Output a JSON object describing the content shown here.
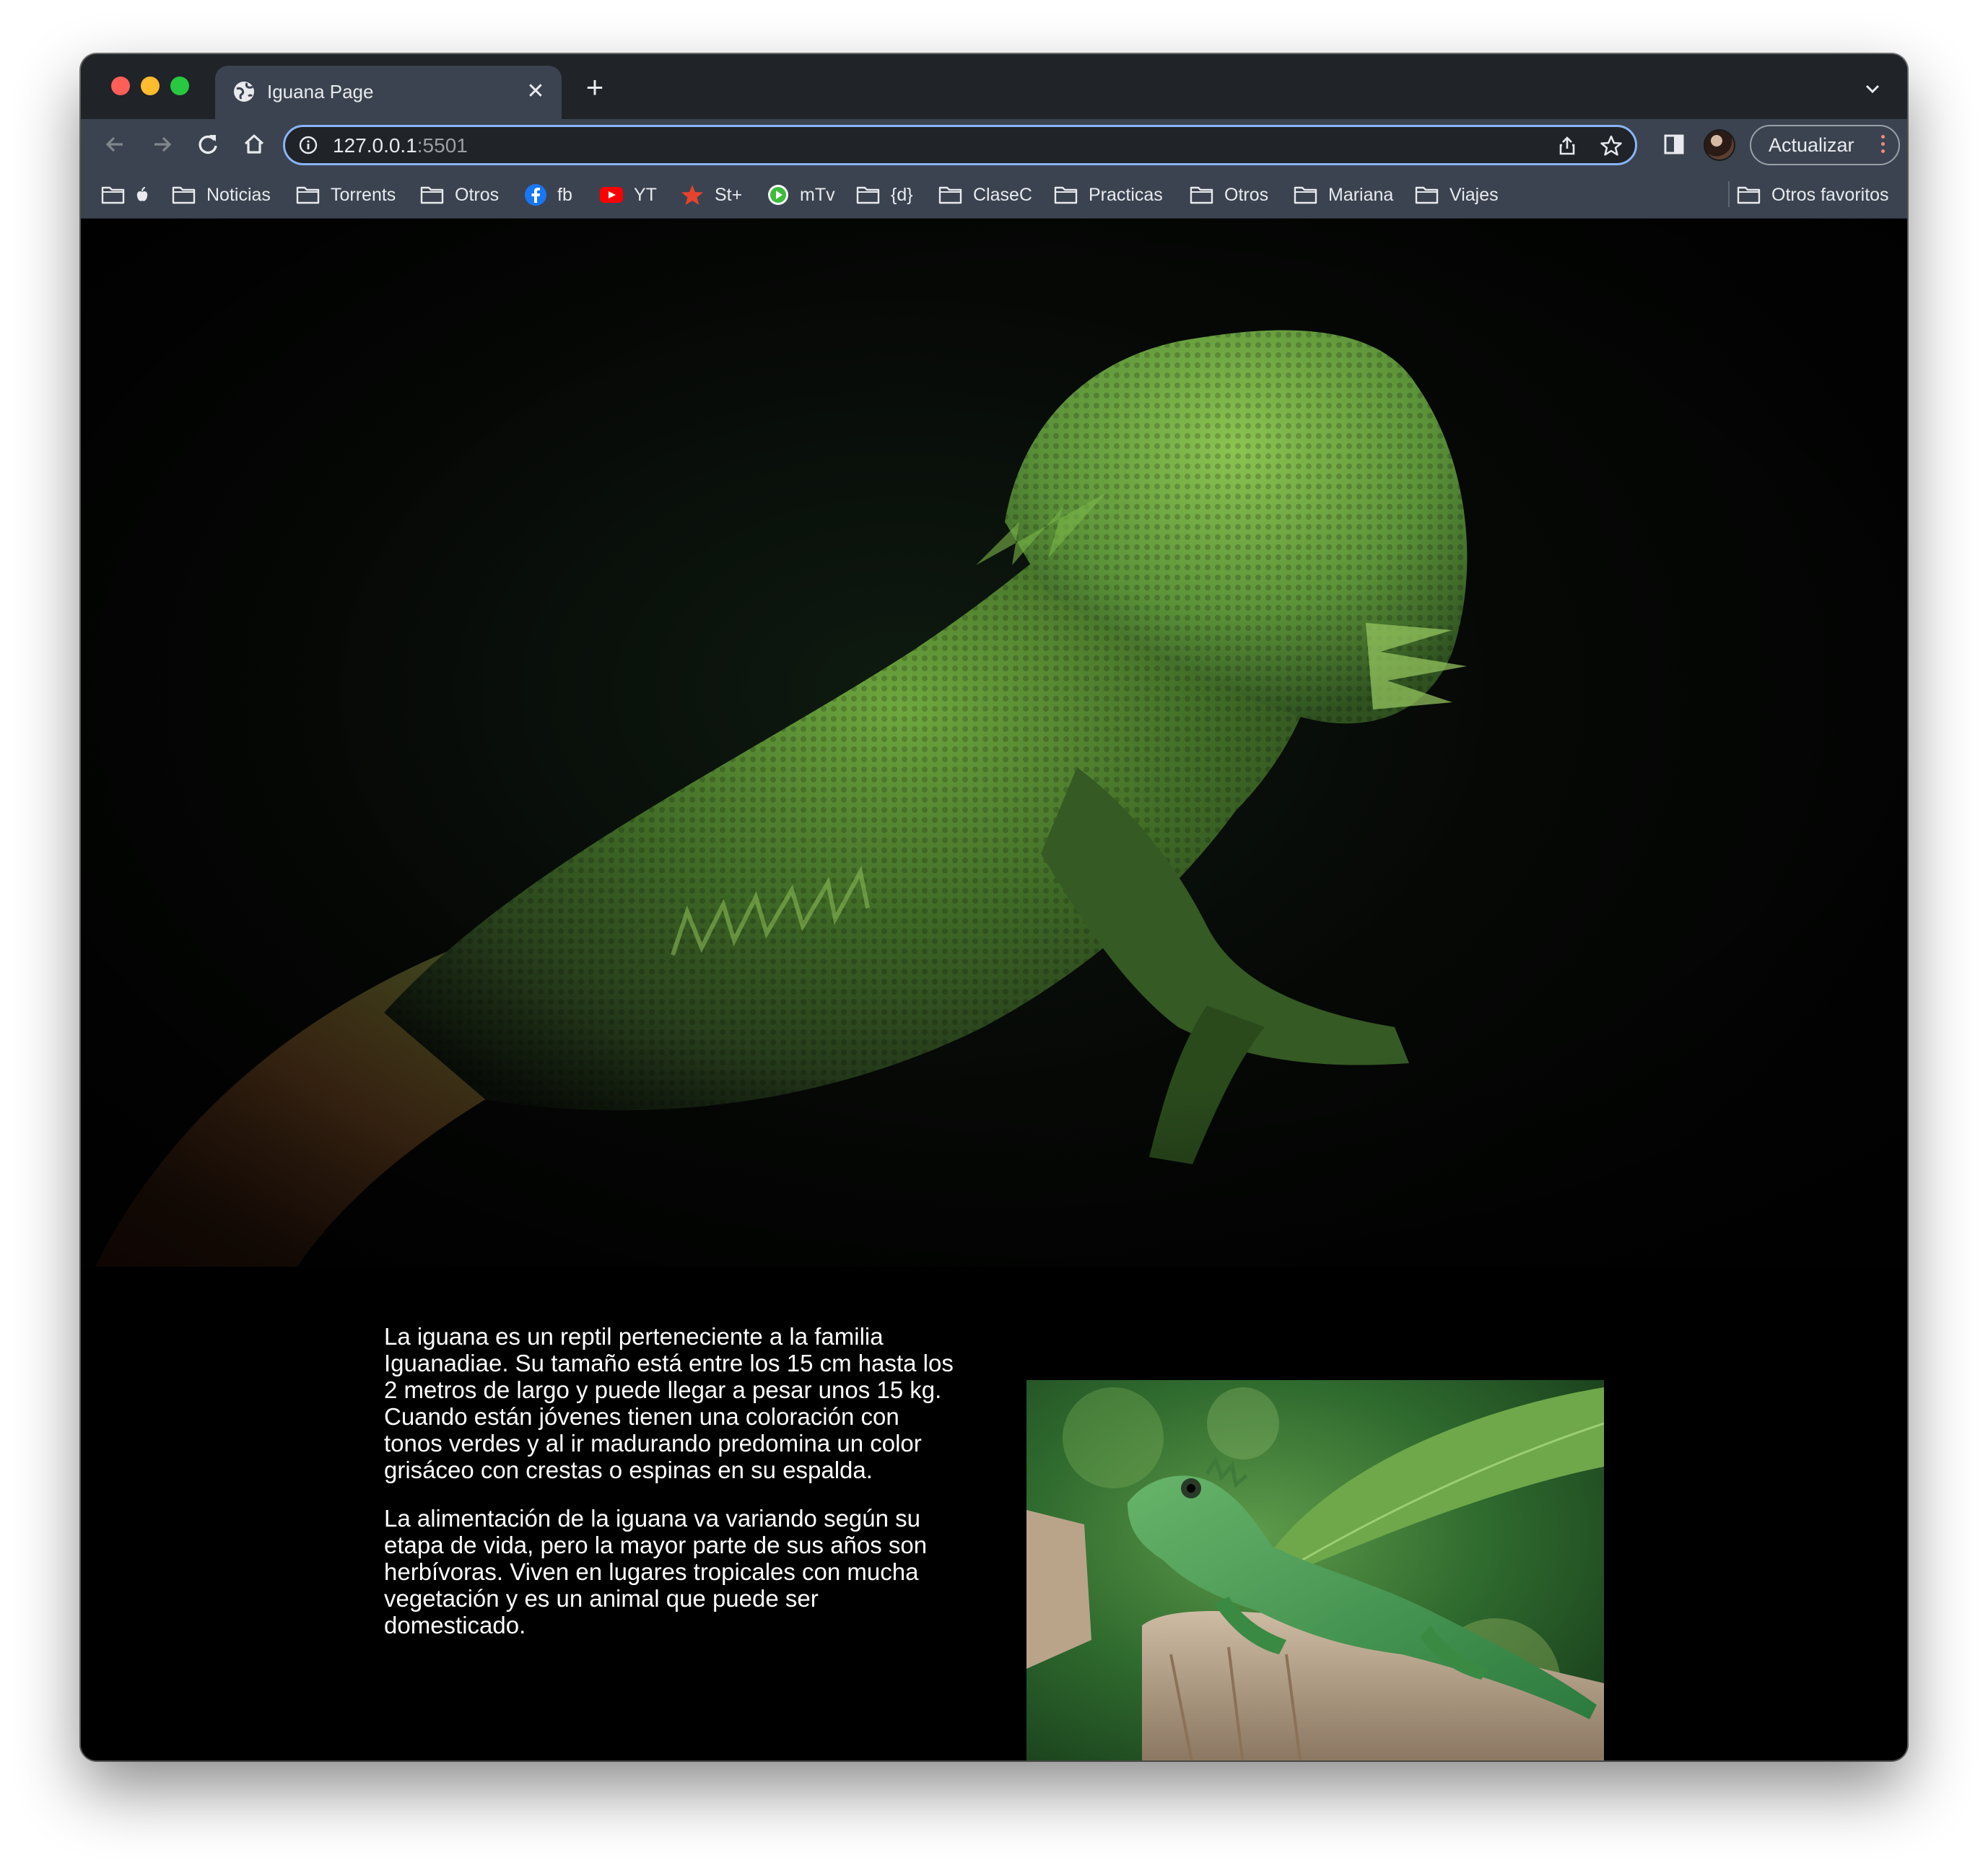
{
  "browser": {
    "tab_title": "Iguana Page",
    "url_host": "127.0.0.1",
    "url_port": ":5501",
    "update_label": "Actualizar",
    "accent_color": "#8ab4f8"
  },
  "bookmarks": {
    "items": [
      {
        "label": "Noticias",
        "icon": "folder-icon"
      },
      {
        "label": "Torrents",
        "icon": "folder-icon"
      },
      {
        "label": "Otros",
        "icon": "folder-icon"
      },
      {
        "label": "fb",
        "icon": "facebook-icon"
      },
      {
        "label": "YT",
        "icon": "youtube-icon"
      },
      {
        "label": "St+",
        "icon": "star-plus-icon"
      },
      {
        "label": "mTv",
        "icon": "play-icon"
      },
      {
        "label": "{d}",
        "icon": "folder-icon"
      },
      {
        "label": "ClaseC",
        "icon": "folder-icon"
      },
      {
        "label": "Practicas",
        "icon": "folder-icon"
      },
      {
        "label": "Otros",
        "icon": "folder-icon"
      },
      {
        "label": "Mariana",
        "icon": "folder-icon"
      },
      {
        "label": "Viajes",
        "icon": "folder-icon"
      }
    ],
    "other_favorites": "Otros favoritos"
  },
  "page": {
    "paragraph_1": "La iguana es un reptil perteneciente a la familia Iguanadiae. Su tamaño está entre los 15 cm hasta los 2 metros de largo y puede llegar a pesar unos 15 kg. Cuando están jóvenes tienen una coloración con tonos verdes y al ir madurando predomina un color grisáceo con crestas o espinas en su espalda.",
    "paragraph_2": "La alimentación de la iguana va variando según su etapa de vida, pero la mayor parte de sus años son herbívoras. Viven en lugares tropicales con mucha vegetación y es un animal que puede ser domesticado."
  }
}
